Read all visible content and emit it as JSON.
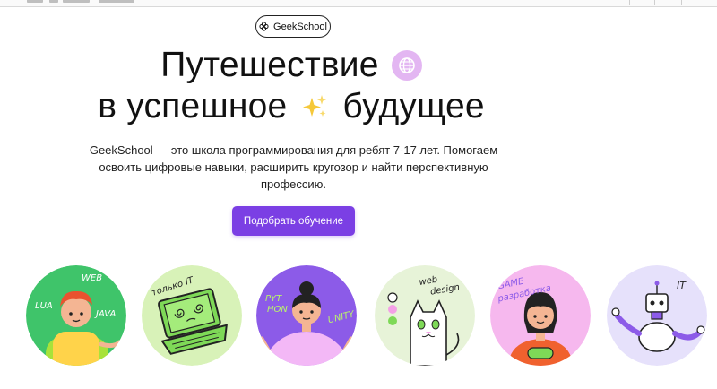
{
  "brand": {
    "name": "GeekSchool"
  },
  "hero": {
    "title_line1": "Путешествие",
    "title_line2_part1": "в успешное",
    "title_line2_part2": "будущее",
    "description": "GeekSchool — это школа программирования для ребят 7-17 лет. Помогаем освоить цифровые навыки, расширить кругозор и найти перспективную профессию.",
    "cta_label": "Подобрать обучение"
  },
  "illustrations": [
    {
      "tags": [
        "WEB",
        "LUA",
        "JAVA"
      ],
      "bg": "#3fc46a",
      "icon": "boy-with-backpack"
    },
    {
      "tags": [
        "только IT"
      ],
      "bg": "#d8f2b8",
      "icon": "laptop-dizzy"
    },
    {
      "tags": [
        "PYT HON",
        "UNITY"
      ],
      "bg": "#8c5be8",
      "icon": "girl-shrugging"
    },
    {
      "tags": [
        "web design"
      ],
      "bg": "#e7f3d8",
      "icon": "cat-designer"
    },
    {
      "tags": [
        "GAME разработка"
      ],
      "bg": "#f6b8ee",
      "icon": "girl-with-gamepad"
    },
    {
      "tags": [
        "IT"
      ],
      "bg": "#e6e1fb",
      "icon": "robot"
    }
  ],
  "colors": {
    "accent": "#7b3fe4",
    "globe_badge": "#e3b6f2"
  }
}
